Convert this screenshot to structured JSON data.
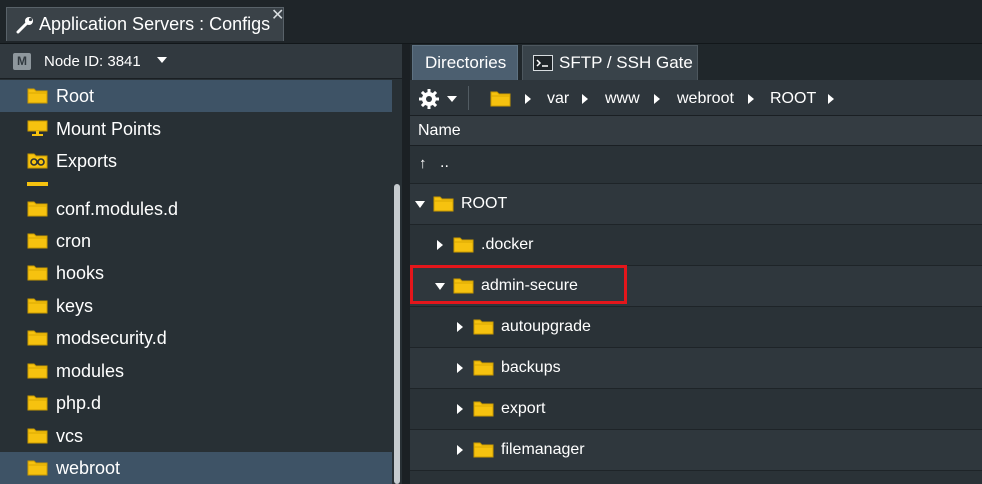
{
  "window": {
    "tab_title": "Application Servers : Configs",
    "close_glyph": "✕",
    "tab_icon": "wrench-icon"
  },
  "node": {
    "label": "Node ID: 3841",
    "icon_letter": "M"
  },
  "sidebar": {
    "items": [
      {
        "label": "Root",
        "icon": "folder-icon",
        "selected": true
      },
      {
        "label": "Mount Points",
        "icon": "mount-points-icon",
        "selected": false
      },
      {
        "label": "Exports",
        "icon": "exports-icon",
        "selected": false
      },
      {
        "label": "conf.modules.d",
        "icon": "folder-icon",
        "selected": false
      },
      {
        "label": "cron",
        "icon": "folder-icon",
        "selected": false
      },
      {
        "label": "hooks",
        "icon": "folder-icon",
        "selected": false
      },
      {
        "label": "keys",
        "icon": "folder-icon",
        "selected": false
      },
      {
        "label": "modsecurity.d",
        "icon": "folder-icon",
        "selected": false
      },
      {
        "label": "modules",
        "icon": "folder-icon",
        "selected": false
      },
      {
        "label": "php.d",
        "icon": "folder-icon",
        "selected": false
      },
      {
        "label": "vcs",
        "icon": "folder-icon",
        "selected": false
      },
      {
        "label": "webroot",
        "icon": "folder-icon",
        "selected": true
      }
    ]
  },
  "tabs": [
    {
      "label": "Directories",
      "active": true
    },
    {
      "label": "SFTP / SSH Gate",
      "active": false,
      "icon": "terminal-icon"
    }
  ],
  "breadcrumb": [
    "var",
    "www",
    "webroot",
    "ROOT"
  ],
  "grid": {
    "column_name": "Name",
    "up_label": "..",
    "up_glyph": "↑",
    "rows": [
      {
        "label": "ROOT",
        "expanded": true
      },
      {
        "label": ".docker",
        "expanded": false
      },
      {
        "label": "admin-secure",
        "expanded": true,
        "highlighted": true
      },
      {
        "label": "autoupgrade",
        "expanded": false
      },
      {
        "label": "backups",
        "expanded": false
      },
      {
        "label": "export",
        "expanded": false
      },
      {
        "label": "filemanager",
        "expanded": false
      }
    ]
  },
  "colors": {
    "folder": "#f6c20f",
    "selection": "#3e5366",
    "highlight": "#e4161b"
  }
}
